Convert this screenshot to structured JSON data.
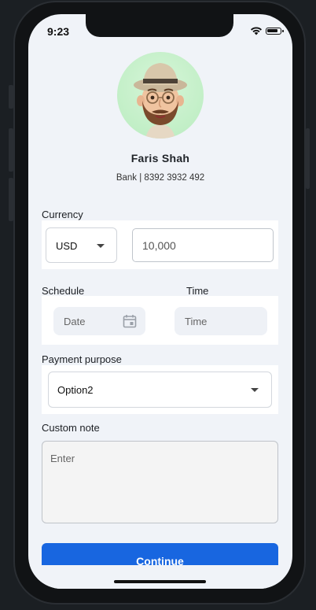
{
  "status_bar": {
    "time": "9:23"
  },
  "profile": {
    "name": "Faris Shah",
    "bank": "Bank | 8392 3932 492"
  },
  "currency": {
    "label": "Currency",
    "selected": "USD",
    "amount": "10,000"
  },
  "schedule": {
    "label": "Schedule",
    "date_placeholder": "Date"
  },
  "time": {
    "label": "Time",
    "placeholder": "Time"
  },
  "purpose": {
    "label": "Payment purpose",
    "selected": "Option2"
  },
  "note": {
    "label": "Custom note",
    "placeholder": "Enter"
  },
  "actions": {
    "continue_label": "Continue"
  },
  "colors": {
    "primary": "#1866e0",
    "avatar_bg": "#bfeec4",
    "screen_bg": "#f0f3f8"
  }
}
